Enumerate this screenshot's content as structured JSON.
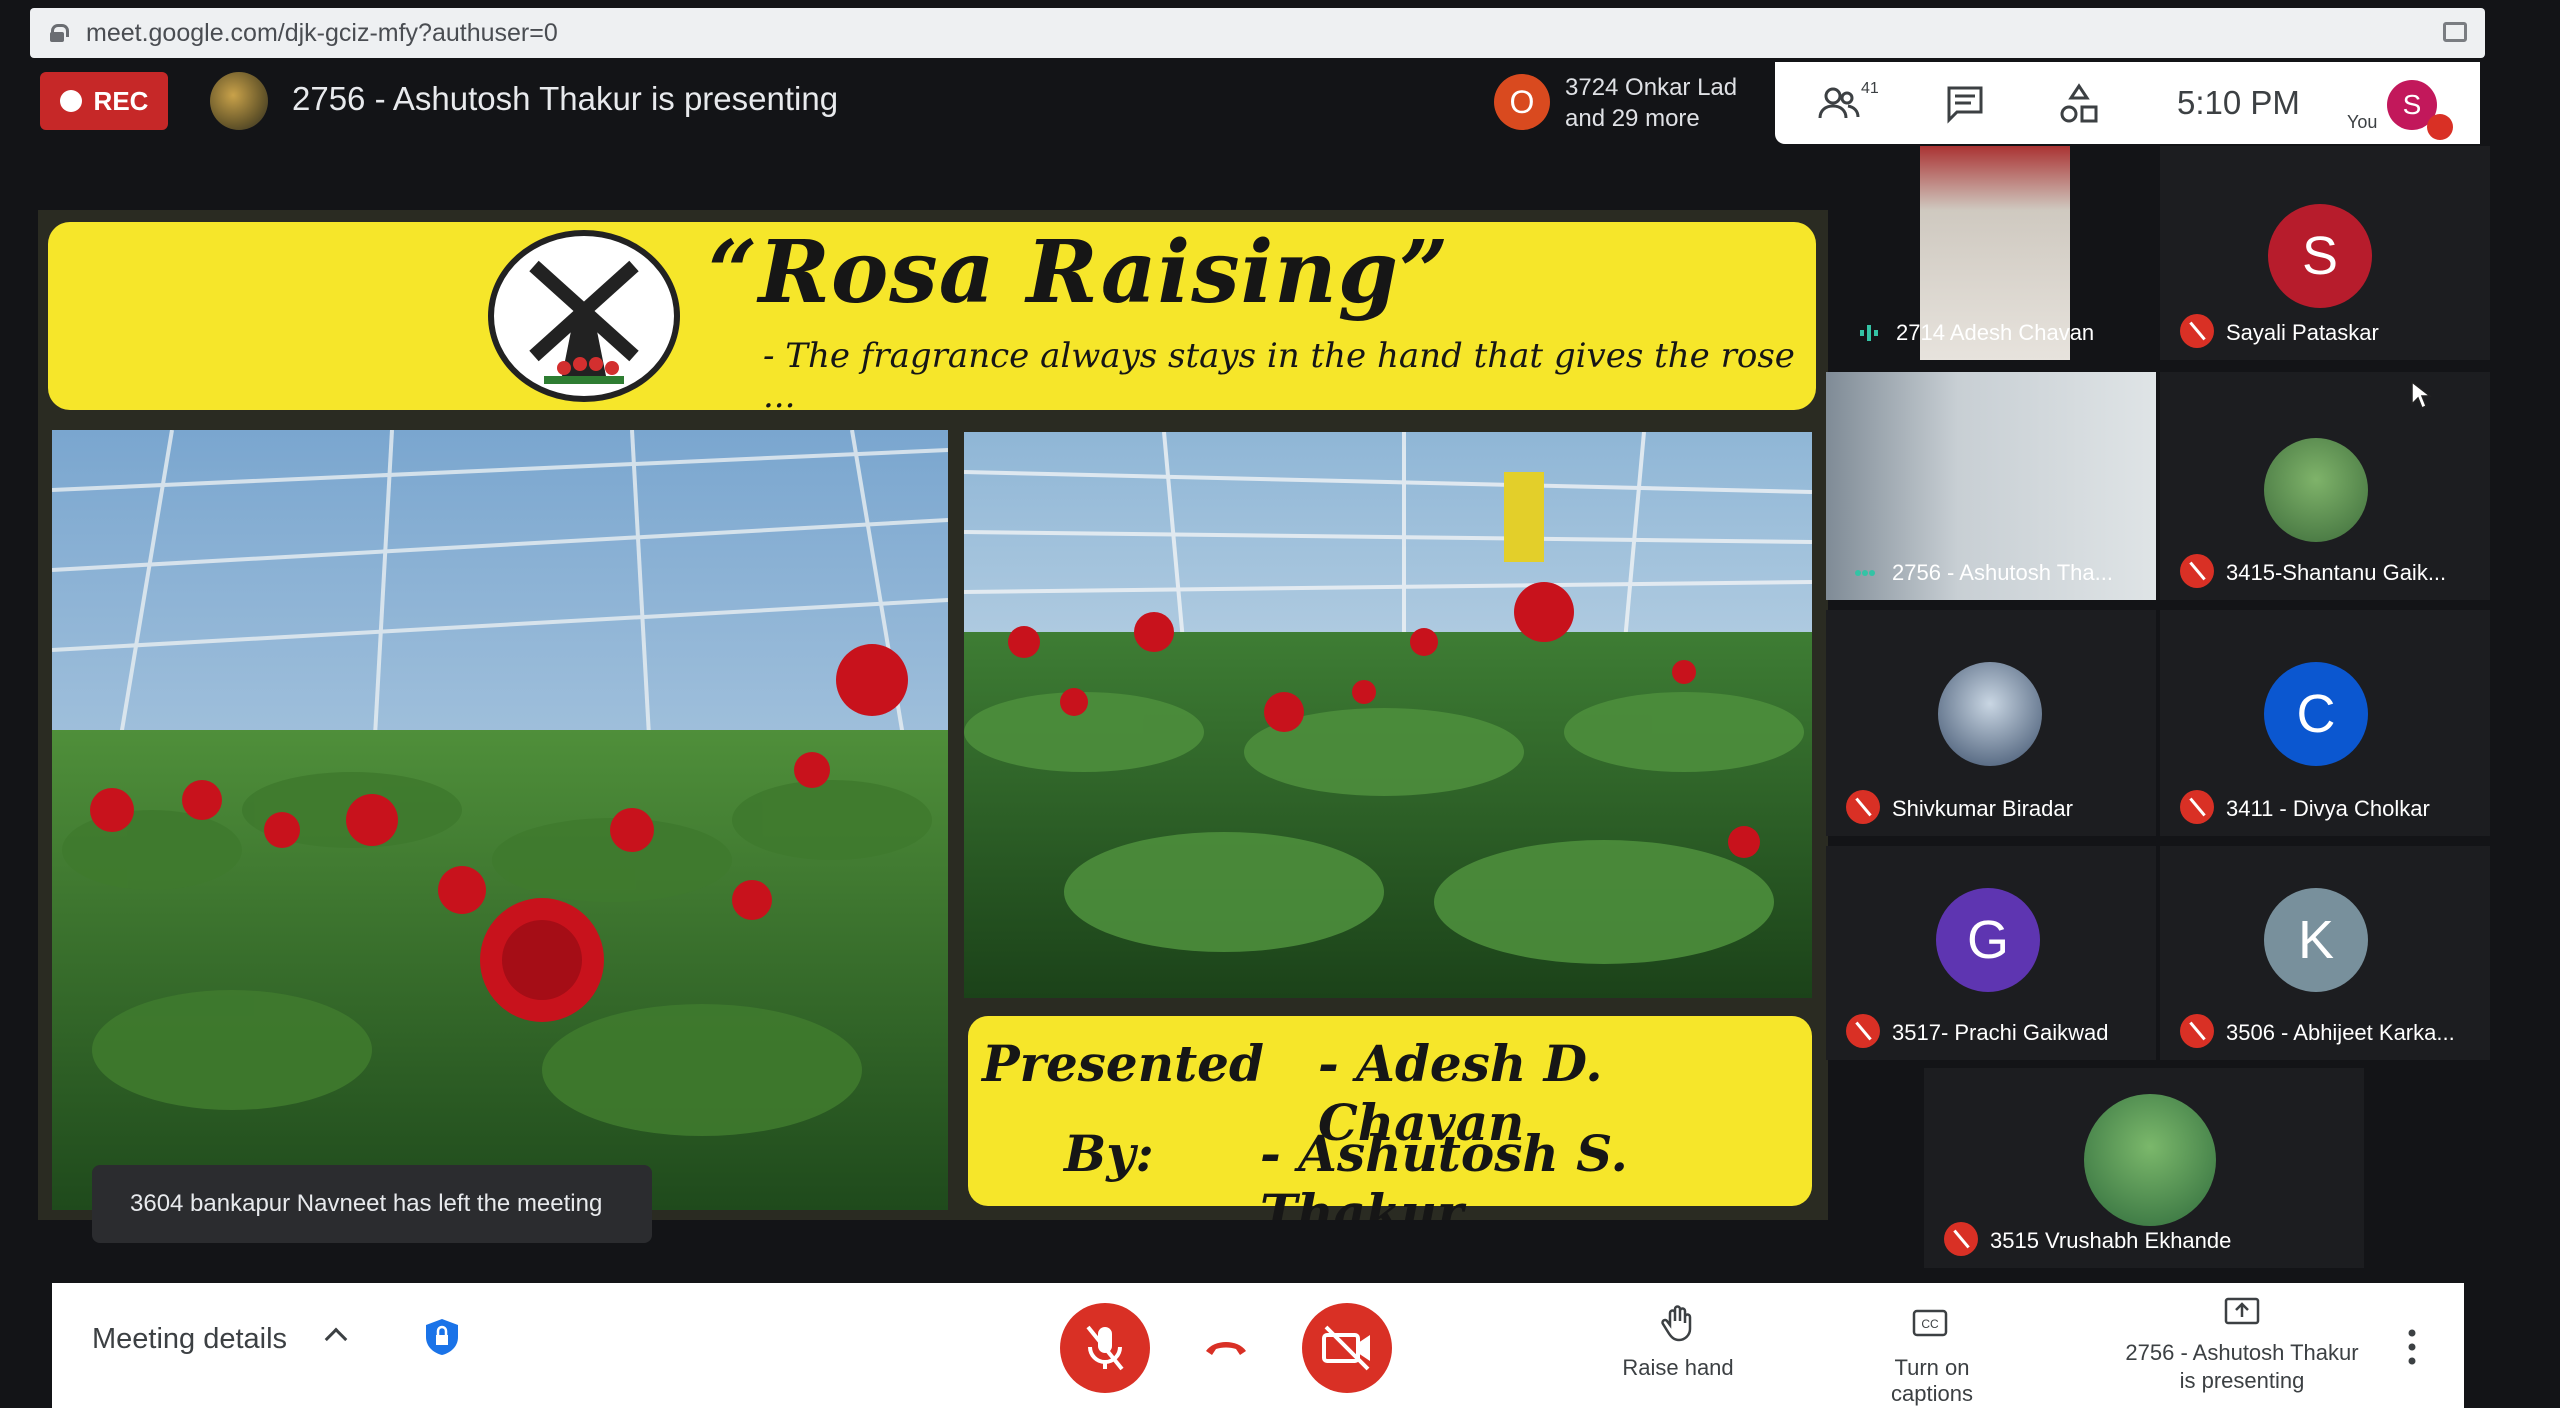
{
  "browser": {
    "url": "meet.google.com/djk-gciz-mfy?authuser=0"
  },
  "header": {
    "rec_label": "REC",
    "presenting_title": "2756 - Ashutosh Thakur is presenting",
    "joined_initial": "O",
    "joined_line1": "3724 Onkar Lad",
    "joined_line2": "and 29 more",
    "people_count": "41",
    "time": "5:10 PM",
    "you_label": "You",
    "self_initial": "S"
  },
  "slide": {
    "title": "“Rosa Raising”",
    "subtitle": "- The fragrance always stays in the hand that gives the rose ...",
    "presented_label": "Presented",
    "by_label": "By:",
    "presenter1": "- Adesh D. Chavan",
    "presenter2": "- Ashutosh S. Thakur"
  },
  "toast": "3604 bankapur Navneet has left the meeting",
  "participants": [
    {
      "name": "2714 Adesh Chavan",
      "type": "video",
      "speaking": true
    },
    {
      "name": "Sayali Pataskar",
      "type": "initial",
      "initial": "S",
      "color": "#b71c2c",
      "muted": true
    },
    {
      "name": "2756 - Ashutosh Tha...",
      "type": "video",
      "speaking": true
    },
    {
      "name": "3415-Shantanu Gaik...",
      "type": "photo",
      "muted": true
    },
    {
      "name": "Shivkumar Biradar",
      "type": "photo",
      "muted": true
    },
    {
      "name": "3411 - Divya Cholkar",
      "type": "initial",
      "initial": "C",
      "color": "#0b57d0",
      "muted": true
    },
    {
      "name": "3517- Prachi Gaikwad",
      "type": "initial",
      "initial": "G",
      "color": "#5e35b1",
      "muted": true
    },
    {
      "name": "3506 - Abhijeet Karka...",
      "type": "initial",
      "initial": "K",
      "color": "#78909c",
      "muted": true
    },
    {
      "name": "3515 Vrushabh Ekhande",
      "type": "photo",
      "muted": true
    }
  ],
  "bottom": {
    "meeting_details": "Meeting details",
    "raise_hand": "Raise hand",
    "captions": "Turn on captions",
    "presenting_line1": "2756 - Ashutosh Thakur",
    "presenting_line2": "is presenting"
  },
  "colors": {
    "danger": "#d93025",
    "banner": "#f6e62a"
  }
}
